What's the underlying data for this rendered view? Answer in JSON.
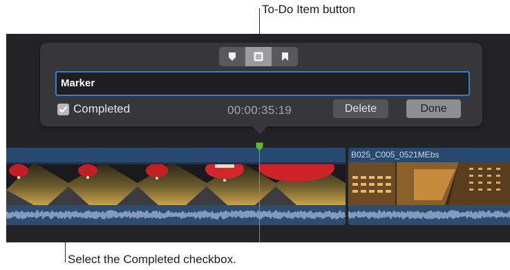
{
  "callouts": {
    "todo_button": "To-Do Item button",
    "completed_checkbox": "Select the Completed checkbox."
  },
  "popover": {
    "segment_buttons": [
      {
        "icon": "standard-marker-icon",
        "active": false
      },
      {
        "icon": "todo-item-icon",
        "active": true
      },
      {
        "icon": "chapter-marker-icon",
        "active": false
      }
    ],
    "marker_name": "Marker",
    "completed_label": "Completed",
    "completed_checked": true,
    "timecode": "00:00:35:19",
    "delete_label": "Delete",
    "done_label": "Done"
  },
  "timeline": {
    "clips": [
      {
        "name": ""
      },
      {
        "name": "B025_C005_0521MEbs"
      }
    ]
  },
  "colors": {
    "accent_focus": "#3f7cc4",
    "marker_green": "#5fb832",
    "clip_blue": "#1b3556"
  }
}
